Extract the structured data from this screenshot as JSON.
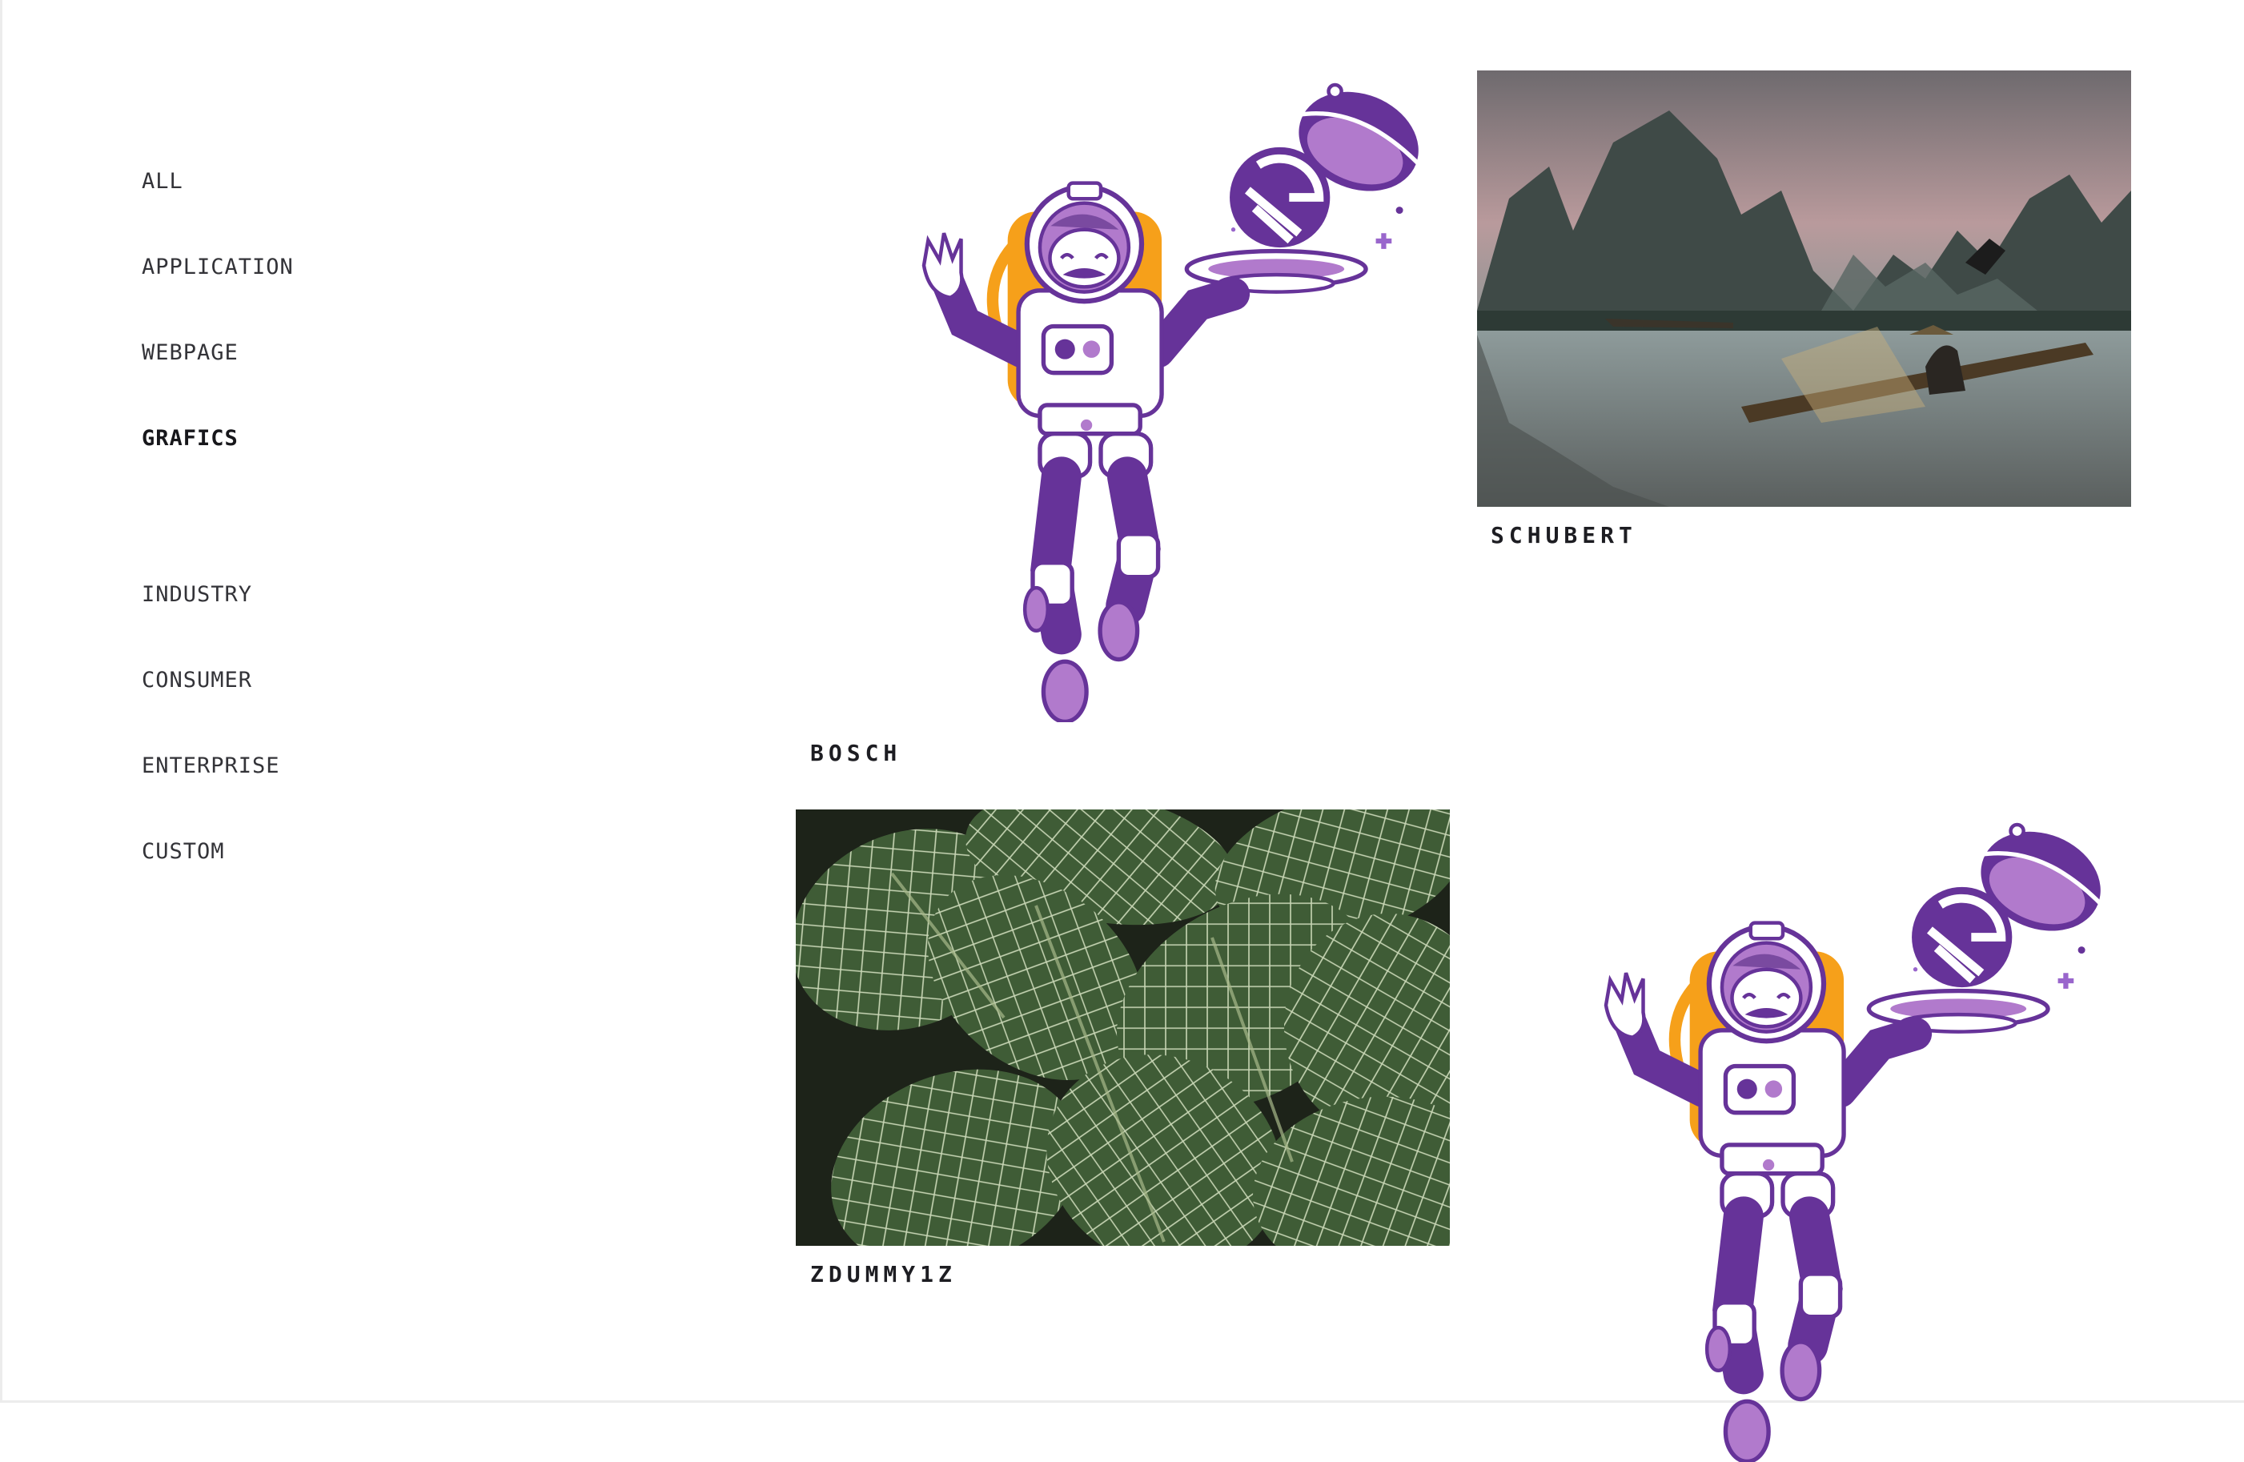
{
  "filters": {
    "type_items": [
      {
        "label": "ALL",
        "active": false
      },
      {
        "label": "APPLICATION",
        "active": false
      },
      {
        "label": "WEBPAGE",
        "active": false
      },
      {
        "label": "GRAFICS",
        "active": true
      }
    ],
    "audience_items": [
      {
        "label": "INDUSTRY"
      },
      {
        "label": "CONSUMER"
      },
      {
        "label": "ENTERPRISE"
      },
      {
        "label": "CUSTOM"
      }
    ]
  },
  "gallery": {
    "items": [
      {
        "caption": "BOSCH",
        "image": "astronaut-waiter-illustration"
      },
      {
        "caption": "SCHUBERT",
        "image": "river-mountains-fisherman-photo"
      },
      {
        "caption": "ZDUMMY1Z",
        "image": "green-leaves-photo"
      },
      {
        "caption": "",
        "image": "astronaut-waiter-illustration"
      }
    ]
  },
  "colors": {
    "purple": "#663399",
    "light_purple": "#b17acc",
    "orange": "#f6a01a",
    "text": "#2a2a2e"
  }
}
